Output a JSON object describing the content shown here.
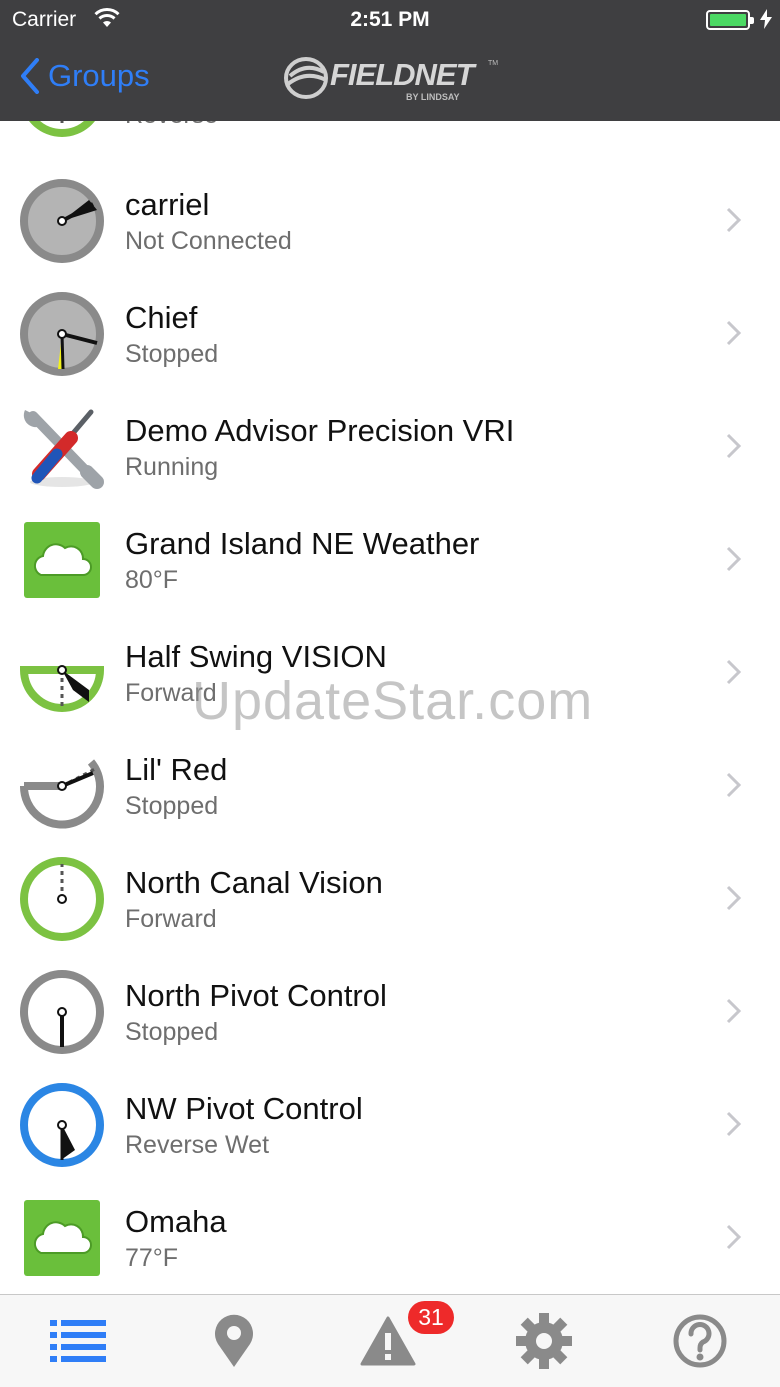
{
  "status_bar": {
    "carrier": "Carrier",
    "time": "2:51 PM"
  },
  "nav": {
    "back_label": "Groups",
    "logo_text": "FIELDNET",
    "logo_sub": "BY LINDSAY",
    "logo_tm": "TM"
  },
  "list": {
    "partial_row": {
      "status": "Reverse",
      "icon": "pivot-green-icon"
    },
    "items": [
      {
        "name": "carriel",
        "status": "Not Connected",
        "icon": "pivot-grey-disconnected-icon"
      },
      {
        "name": "Chief",
        "status": "Stopped",
        "icon": "pivot-grey-stopped-icon"
      },
      {
        "name": "Demo Advisor Precision VRI",
        "status": "Running",
        "icon": "wrench-screwdriver-icon"
      },
      {
        "name": "Grand Island NE Weather",
        "status": "80°F",
        "icon": "weather-cloud-icon"
      },
      {
        "name": "Half Swing VISION",
        "status": "Forward",
        "icon": "half-pivot-green-icon"
      },
      {
        "name": "Lil' Red",
        "status": "Stopped",
        "icon": "partial-pivot-grey-icon"
      },
      {
        "name": "North Canal Vision",
        "status": "Forward",
        "icon": "pivot-green-icon"
      },
      {
        "name": "North Pivot Control",
        "status": "Stopped",
        "icon": "pivot-grey-icon"
      },
      {
        "name": "NW Pivot Control",
        "status": "Reverse Wet",
        "icon": "pivot-blue-icon"
      },
      {
        "name": "Omaha",
        "status": "77°F",
        "icon": "weather-cloud-icon"
      }
    ]
  },
  "watermark": "UpdateStar.com",
  "tabbar": {
    "tabs": [
      {
        "name": "list-tab",
        "icon": "list-icon",
        "active": true
      },
      {
        "name": "map-tab",
        "icon": "map-pin-icon",
        "active": false
      },
      {
        "name": "alerts-tab",
        "icon": "warning-icon",
        "active": false
      },
      {
        "name": "settings-tab",
        "icon": "gear-icon",
        "active": false
      },
      {
        "name": "help-tab",
        "icon": "help-icon",
        "active": false
      }
    ],
    "alerts_badge": "31"
  },
  "colors": {
    "header_bg": "#3f3f41",
    "accent_blue": "#2f7ef7",
    "pivot_green": "#7cc242",
    "pivot_grey": "#8a8a8a",
    "pivot_blue": "#2b86e4",
    "badge_red": "#ee2a2a",
    "weather_green": "#6abf3b"
  }
}
